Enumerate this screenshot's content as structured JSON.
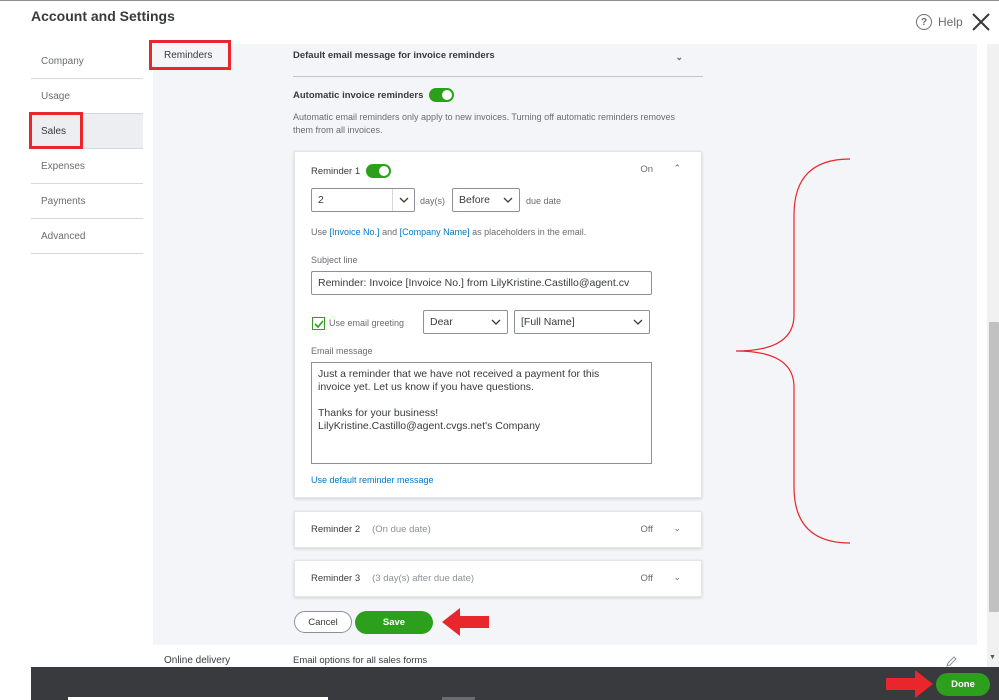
{
  "header": {
    "title": "Account and Settings",
    "help_label": "Help",
    "help_icon": "?"
  },
  "sidebar": {
    "items": [
      {
        "label": "Company"
      },
      {
        "label": "Usage"
      },
      {
        "label": "Sales"
      },
      {
        "label": "Expenses"
      },
      {
        "label": "Payments"
      },
      {
        "label": "Advanced"
      }
    ],
    "active": "Sales"
  },
  "section": {
    "label": "Reminders",
    "default_email_header": "Default email message for invoice reminders",
    "auto_label": "Automatic invoice reminders",
    "auto_enabled": true,
    "auto_note": "Automatic email reminders only apply to new invoices. Turning off automatic reminders removes them from all invoices."
  },
  "reminder1": {
    "title": "Reminder 1",
    "enabled": true,
    "state": "On",
    "days_value": "2",
    "days_unit": "day(s)",
    "timing_value": "Before",
    "due_suffix": "due date",
    "placeholder_use": "Use",
    "placeholder_invoice": "[Invoice No.]",
    "placeholder_and": "and",
    "placeholder_company": "[Company Name]",
    "placeholder_suffix": "as placeholders in the email.",
    "subject_label": "Subject line",
    "subject_value": "Reminder: Invoice [Invoice No.] from LilyKristine.Castillo@agent.cv",
    "greeting_checked": true,
    "greeting_label": "Use email greeting",
    "greeting_value": "Dear",
    "name_value": "[Full Name]",
    "message_label": "Email message",
    "message_value": "Just a reminder that we have not received a payment for this\ninvoice yet. Let us know if you have questions.\n\nThanks for your business!\nLilyKristine.Castillo@agent.cvgs.net's Company",
    "default_link": "Use default reminder message"
  },
  "reminder2": {
    "title": "Reminder 2",
    "subtitle": "(On due date)",
    "state": "Off"
  },
  "reminder3": {
    "title": "Reminder 3",
    "subtitle": "(3 day(s) after due date)",
    "state": "Off"
  },
  "actions": {
    "cancel_label": "Cancel",
    "save_label": "Save"
  },
  "online_delivery": {
    "label": "Online delivery",
    "description": "Email options for all sales forms"
  },
  "footer": {
    "done_label": "Done"
  },
  "colors": {
    "accent_green": "#2ca01c",
    "annotation_red": "#e8262b",
    "link_blue": "#0077c5",
    "footer_bg": "#393a3d"
  }
}
